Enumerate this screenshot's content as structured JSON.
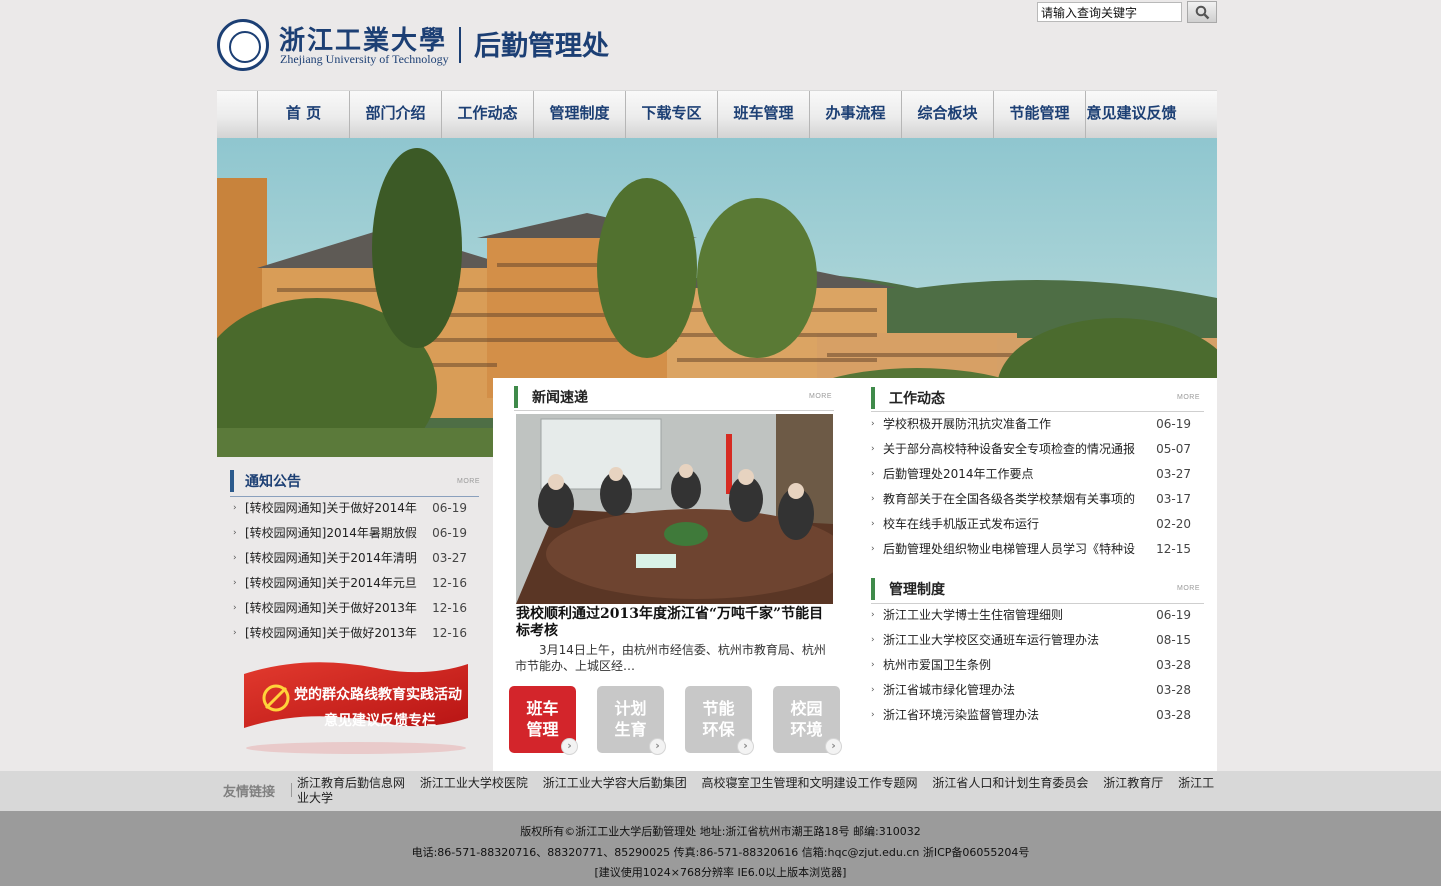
{
  "header": {
    "school_cn": "浙江工業大學",
    "school_en": "Zhejiang University of Technology",
    "dept_name": "后勤管理处"
  },
  "search": {
    "placeholder": "请输入查询关键字",
    "value": "请输入查询关键字"
  },
  "nav": [
    "首  页",
    "部门介绍",
    "工作动态",
    "管理制度",
    "下载专区",
    "班车管理",
    "办事流程",
    "综合板块",
    "节能管理",
    "意见建议反馈"
  ],
  "notices": {
    "title": "通知公告",
    "more": "MORE",
    "items": [
      {
        "title": "[转校园网通知]关于做好2014年",
        "date": "06-19"
      },
      {
        "title": "[转校园网通知]2014年暑期放假",
        "date": "06-19"
      },
      {
        "title": "[转校园网通知]关于2014年清明",
        "date": "03-27"
      },
      {
        "title": "[转校园网通知]关于2014年元旦",
        "date": "12-16"
      },
      {
        "title": "[转校园网通知]关于做好2013年",
        "date": "12-16"
      },
      {
        "title": "[转校园网通知]关于做好2013年",
        "date": "12-16"
      }
    ]
  },
  "party_banner": {
    "line1": "党的群众路线教育实践活动",
    "line2": "意见建议反馈专栏"
  },
  "news": {
    "title": "新闻速递",
    "more": "MORE",
    "headline": "我校顺利通过2013年度浙江省“万吨千家”节能目标考核",
    "summary": "3月14日上午，由杭州市经信委、杭州市教育局、杭州市节能办、上城区经…"
  },
  "tiles": [
    {
      "line1": "班车",
      "line2": "管理",
      "color": "#d3252b"
    },
    {
      "line1": "计划",
      "line2": "生育",
      "color": "#c8c8c8"
    },
    {
      "line1": "节能",
      "line2": "环保",
      "color": "#c8c8c8"
    },
    {
      "line1": "校园",
      "line2": "环境",
      "color": "#c8c8c8"
    }
  ],
  "work": {
    "title": "工作动态",
    "more": "MORE",
    "items": [
      {
        "title": "学校积极开展防汛抗灾准备工作",
        "date": "06-19"
      },
      {
        "title": "关于部分高校特种设备安全专项检查的情况通报",
        "date": "05-07"
      },
      {
        "title": "后勤管理处2014年工作要点",
        "date": "03-27"
      },
      {
        "title": "教育部关于在全国各级各类学校禁烟有关事项的",
        "date": "03-17"
      },
      {
        "title": "校车在线手机版正式发布运行",
        "date": "02-20"
      },
      {
        "title": "后勤管理处组织物业电梯管理人员学习《特种设",
        "date": "12-15"
      }
    ]
  },
  "rules": {
    "title": "管理制度",
    "more": "MORE",
    "items": [
      {
        "title": "浙江工业大学博士生住宿管理细则",
        "date": "06-19"
      },
      {
        "title": "浙江工业大学校区交通班车运行管理办法",
        "date": "08-15"
      },
      {
        "title": "杭州市爱国卫生条例",
        "date": "03-28"
      },
      {
        "title": "浙江省城市绿化管理办法",
        "date": "03-28"
      },
      {
        "title": "浙江省环境污染监督管理办法",
        "date": "03-28"
      }
    ]
  },
  "links": {
    "title": "友情链接",
    "items": [
      "浙江教育后勤信息网",
      "浙江工业大学校医院",
      "浙江工业大学容大后勤集团",
      "高校寝室卫生管理和文明建设工作专题网",
      "浙江省人口和计划生育委员会",
      "浙江教育厅",
      "浙江工业大学"
    ]
  },
  "footer": {
    "line1": "版权所有©浙江工业大学后勤管理处  地址:浙江省杭州市潮王路18号  邮编:310032",
    "line2": "电话:86-571-88320716、88320771、85290025 传真:86-571-88320616 信箱:hqc@zjut.edu.cn 浙ICP备06055204号",
    "line3": "[建议使用1024×768分辨率  IE6.0以上版本浏览器]"
  },
  "colors": {
    "brand": "#1c3f74",
    "accent_green": "#3f8a4a",
    "accent_blue": "#2c5a8c",
    "tile_red": "#d3252b"
  }
}
